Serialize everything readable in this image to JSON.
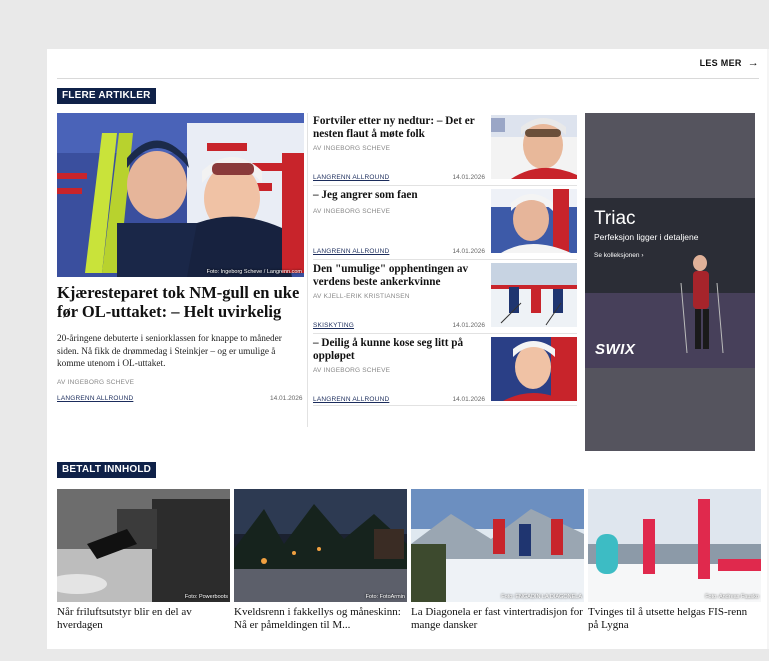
{
  "header": {
    "les_mer": "LES MER",
    "arrow": "→"
  },
  "sections": {
    "flere": "FLERE ARTIKLER",
    "betalt": "BETALT INNHOLD"
  },
  "main_article": {
    "title": "Kjæresteparet tok NM-gull en uke før OL-uttaket: – Helt uvirkelig",
    "lede": "20-åringene debuterte i seniorklassen for knappe to måneder siden. Nå fikk de drømmedag i Steinkjer – og er umulige å komme utenom i OL-uttaket.",
    "byline": "AV INGEBORG SCHEVE",
    "category": "LANGRENN ALLROUND",
    "date": "14.01.2026",
    "photo_credit": "Foto: Ingeborg Scheve / Langrenn.com"
  },
  "side_articles": [
    {
      "title": "Fortviler etter ny nedtur: – Det er nesten flaut å møte folk",
      "byline": "AV INGEBORG SCHEVE",
      "category": "LANGRENN ALLROUND",
      "date": "14.01.2026"
    },
    {
      "title": "– Jeg angrer som faen",
      "byline": "AV INGEBORG SCHEVE",
      "category": "LANGRENN ALLROUND",
      "date": "14.01.2026"
    },
    {
      "title": "Den \"umulige\" opphentingen av verdens beste ankerkvinne",
      "byline": "AV KJELL-ERIK KRISTIANSEN",
      "category": "SKISKYTING",
      "date": "14.01.2026"
    },
    {
      "title": "– Deilig å kunne kose seg litt på oppløpet",
      "byline": "AV INGEBORG SCHEVE",
      "category": "LANGRENN ALLROUND",
      "date": "14.01.2026"
    }
  ],
  "ad": {
    "title": "Triac",
    "tagline": "Perfeksjon ligger i detaljene",
    "cta": "Se kolleksjonen  ›",
    "brand": "SWIX"
  },
  "paid": [
    {
      "title": "Når friluftsutstyr blir en del av hverdagen",
      "credit": "Foto: Powerboots"
    },
    {
      "title": "Kveldsrenn i fakkellys og måneskinn: Nå er påmeldingen til M...",
      "credit": "Foto: FotoArmin"
    },
    {
      "title": "La Diagonela er fast vintertradisjon for mange dansker",
      "credit": "Foto: ENGADIN LA DIAGONELA"
    },
    {
      "title": "Tvinges til å utsette helgas FIS-renn på Lygna",
      "credit": "Foto: Andreas Fausko"
    }
  ]
}
